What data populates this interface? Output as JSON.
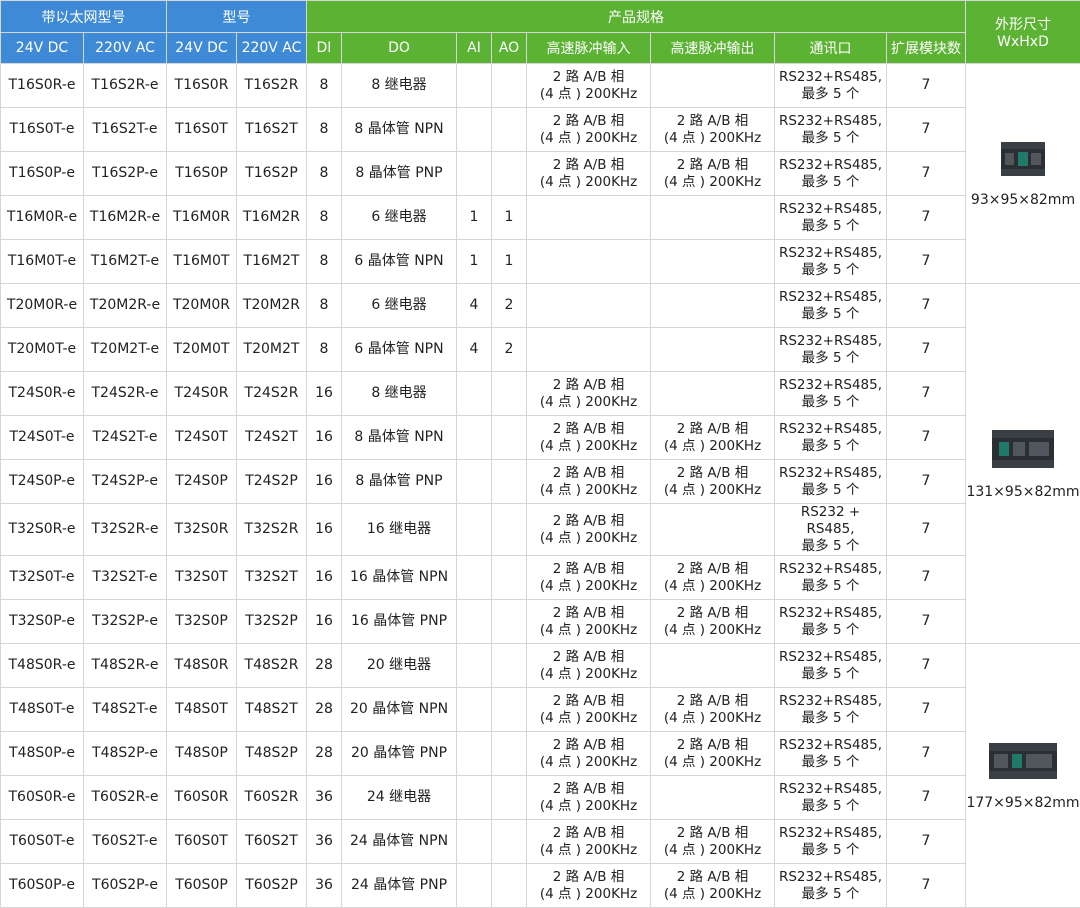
{
  "header": {
    "eth_model": "带以太网型号",
    "model": "型号",
    "spec": "产品规格",
    "dims": "外形尺寸",
    "dims_sub": "WxHxD",
    "v24": "24V DC",
    "v220": "220V AC",
    "di": "DI",
    "do": "DO",
    "ai": "AI",
    "ao": "AO",
    "hs_in": "高速脉冲输入",
    "hs_out": "高速脉冲输出",
    "comm": "通讯口",
    "ext": "扩展模块数"
  },
  "rows": [
    {
      "e24": "T16S0R-e",
      "e220": "T16S2R-e",
      "m24": "T16S0R",
      "m220": "T16S2R",
      "di": "8",
      "do": "8 继电器",
      "ai": "",
      "ao": "",
      "hin1": "2 路 A/B 相",
      "hin2": "(4 点 ) 200KHz",
      "hout1": "",
      "hout2": "",
      "comm1": "RS232+RS485,",
      "comm2": "最多 5 个",
      "ext": "7"
    },
    {
      "e24": "T16S0T-e",
      "e220": "T16S2T-e",
      "m24": "T16S0T",
      "m220": "T16S2T",
      "di": "8",
      "do": "8 晶体管 NPN",
      "ai": "",
      "ao": "",
      "hin1": "2 路 A/B 相",
      "hin2": "(4 点 ) 200KHz",
      "hout1": "2 路 A/B 相",
      "hout2": "(4 点 ) 200KHz",
      "comm1": "RS232+RS485,",
      "comm2": "最多 5 个",
      "ext": "7"
    },
    {
      "e24": "T16S0P-e",
      "e220": "T16S2P-e",
      "m24": "T16S0P",
      "m220": "T16S2P",
      "di": "8",
      "do": "8 晶体管 PNP",
      "ai": "",
      "ao": "",
      "hin1": "2 路 A/B 相",
      "hin2": "(4 点 ) 200KHz",
      "hout1": "2 路 A/B 相",
      "hout2": "(4 点 ) 200KHz",
      "comm1": "RS232+RS485,",
      "comm2": "最多 5 个",
      "ext": "7"
    },
    {
      "e24": "T16M0R-e",
      "e220": "T16M2R-e",
      "m24": "T16M0R",
      "m220": "T16M2R",
      "di": "8",
      "do": "6 继电器",
      "ai": "1",
      "ao": "1",
      "hin1": "",
      "hin2": "",
      "hout1": "",
      "hout2": "",
      "comm1": "RS232+RS485,",
      "comm2": "最多 5 个",
      "ext": "7"
    },
    {
      "e24": "T16M0T-e",
      "e220": "T16M2T-e",
      "m24": "T16M0T",
      "m220": "T16M2T",
      "di": "8",
      "do": "6 晶体管 NPN",
      "ai": "1",
      "ao": "1",
      "hin1": "",
      "hin2": "",
      "hout1": "",
      "hout2": "",
      "comm1": "RS232+RS485,",
      "comm2": "最多 5 个",
      "ext": "7"
    },
    {
      "e24": "T20M0R-e",
      "e220": "T20M2R-e",
      "m24": "T20M0R",
      "m220": "T20M2R",
      "di": "8",
      "do": "6 继电器",
      "ai": "4",
      "ao": "2",
      "hin1": "",
      "hin2": "",
      "hout1": "",
      "hout2": "",
      "comm1": "RS232+RS485,",
      "comm2": "最多 5 个",
      "ext": "7"
    },
    {
      "e24": "T20M0T-e",
      "e220": "T20M2T-e",
      "m24": "T20M0T",
      "m220": "T20M2T",
      "di": "8",
      "do": "6 晶体管 NPN",
      "ai": "4",
      "ao": "2",
      "hin1": "",
      "hin2": "",
      "hout1": "",
      "hout2": "",
      "comm1": "RS232+RS485,",
      "comm2": "最多 5 个",
      "ext": "7"
    },
    {
      "e24": "T24S0R-e",
      "e220": "T24S2R-e",
      "m24": "T24S0R",
      "m220": "T24S2R",
      "di": "16",
      "do": "8 继电器",
      "ai": "",
      "ao": "",
      "hin1": "2 路 A/B 相",
      "hin2": "(4 点 ) 200KHz",
      "hout1": "",
      "hout2": "",
      "comm1": "RS232+RS485,",
      "comm2": "最多 5 个",
      "ext": "7"
    },
    {
      "e24": "T24S0T-e",
      "e220": "T24S2T-e",
      "m24": "T24S0T",
      "m220": "T24S2T",
      "di": "16",
      "do": "8 晶体管 NPN",
      "ai": "",
      "ao": "",
      "hin1": "2 路 A/B 相",
      "hin2": "(4 点 ) 200KHz",
      "hout1": "2 路 A/B 相",
      "hout2": "(4 点 ) 200KHz",
      "comm1": "RS232+RS485,",
      "comm2": "最多 5 个",
      "ext": "7"
    },
    {
      "e24": "T24S0P-e",
      "e220": "T24S2P-e",
      "m24": "T24S0P",
      "m220": "T24S2P",
      "di": "16",
      "do": "8 晶体管 PNP",
      "ai": "",
      "ao": "",
      "hin1": "2 路 A/B 相",
      "hin2": "(4 点 ) 200KHz",
      "hout1": "2 路 A/B 相",
      "hout2": "(4 点 ) 200KHz",
      "comm1": "RS232+RS485,",
      "comm2": "最多 5 个",
      "ext": "7"
    },
    {
      "e24": "T32S0R-e",
      "e220": "T32S2R-e",
      "m24": "T32S0R",
      "m220": "T32S2R",
      "di": "16",
      "do": "16 继电器",
      "ai": "",
      "ao": "",
      "hin1": "2 路 A/B 相",
      "hin2": "(4 点 ) 200KHz",
      "hout1": "",
      "hout2": "",
      "comm1": "RS232 + RS485,",
      "comm2": "最多 5 个",
      "ext": "7"
    },
    {
      "e24": "T32S0T-e",
      "e220": "T32S2T-e",
      "m24": "T32S0T",
      "m220": "T32S2T",
      "di": "16",
      "do": "16 晶体管 NPN",
      "ai": "",
      "ao": "",
      "hin1": "2 路 A/B 相",
      "hin2": "(4 点 ) 200KHz",
      "hout1": "2 路 A/B 相",
      "hout2": "(4 点 ) 200KHz",
      "comm1": "RS232+RS485,",
      "comm2": "最多 5 个",
      "ext": "7"
    },
    {
      "e24": "T32S0P-e",
      "e220": "T32S2P-e",
      "m24": "T32S0P",
      "m220": "T32S2P",
      "di": "16",
      "do": "16 晶体管 PNP",
      "ai": "",
      "ao": "",
      "hin1": "2 路 A/B 相",
      "hin2": "(4 点 ) 200KHz",
      "hout1": "2 路 A/B 相",
      "hout2": "(4 点 ) 200KHz",
      "comm1": "RS232+RS485,",
      "comm2": "最多 5 个",
      "ext": "7"
    },
    {
      "e24": "T48S0R-e",
      "e220": "T48S2R-e",
      "m24": "T48S0R",
      "m220": "T48S2R",
      "di": "28",
      "do": "20 继电器",
      "ai": "",
      "ao": "",
      "hin1": "2 路 A/B 相",
      "hin2": "(4 点 ) 200KHz",
      "hout1": "",
      "hout2": "",
      "comm1": "RS232+RS485,",
      "comm2": "最多 5 个",
      "ext": "7"
    },
    {
      "e24": "T48S0T-e",
      "e220": "T48S2T-e",
      "m24": "T48S0T",
      "m220": "T48S2T",
      "di": "28",
      "do": "20 晶体管 NPN",
      "ai": "",
      "ao": "",
      "hin1": "2 路 A/B 相",
      "hin2": "(4 点 ) 200KHz",
      "hout1": "2 路 A/B 相",
      "hout2": "(4 点 ) 200KHz",
      "comm1": "RS232+RS485,",
      "comm2": "最多 5 个",
      "ext": "7"
    },
    {
      "e24": "T48S0P-e",
      "e220": "T48S2P-e",
      "m24": "T48S0P",
      "m220": "T48S2P",
      "di": "28",
      "do": "20 晶体管 PNP",
      "ai": "",
      "ao": "",
      "hin1": "2 路 A/B 相",
      "hin2": "(4 点 ) 200KHz",
      "hout1": "2 路 A/B 相",
      "hout2": "(4 点 ) 200KHz",
      "comm1": "RS232+RS485,",
      "comm2": "最多 5 个",
      "ext": "7"
    },
    {
      "e24": "T60S0R-e",
      "e220": "T60S2R-e",
      "m24": "T60S0R",
      "m220": "T60S2R",
      "di": "36",
      "do": "24 继电器",
      "ai": "",
      "ao": "",
      "hin1": "2 路 A/B 相",
      "hin2": "(4 点 ) 200KHz",
      "hout1": "",
      "hout2": "",
      "comm1": "RS232+RS485,",
      "comm2": "最多 5 个",
      "ext": "7"
    },
    {
      "e24": "T60S0T-e",
      "e220": "T60S2T-e",
      "m24": "T60S0T",
      "m220": "T60S2T",
      "di": "36",
      "do": "24 晶体管 NPN",
      "ai": "",
      "ao": "",
      "hin1": "2 路 A/B 相",
      "hin2": "(4 点 ) 200KHz",
      "hout1": "2 路 A/B 相",
      "hout2": "(4 点 ) 200KHz",
      "comm1": "RS232+RS485,",
      "comm2": "最多 5 个",
      "ext": "7"
    },
    {
      "e24": "T60S0P-e",
      "e220": "T60S2P-e",
      "m24": "T60S0P",
      "m220": "T60S2P",
      "di": "36",
      "do": "24 晶体管 PNP",
      "ai": "",
      "ao": "",
      "hin1": "2 路 A/B 相",
      "hin2": "(4 点 ) 200KHz",
      "hout1": "2 路 A/B 相",
      "hout2": "(4 点 ) 200KHz",
      "comm1": "RS232+RS485,",
      "comm2": "最多 5 个",
      "ext": "7"
    }
  ],
  "dimension_groups": [
    {
      "label": "93×95×82mm",
      "rows": 5,
      "icon": "plc-small-icon"
    },
    {
      "label": "131×95×82mm",
      "rows": 8,
      "icon": "plc-medium-icon"
    },
    {
      "label": "177×95×82mm",
      "rows": 6,
      "icon": "plc-large-icon"
    }
  ],
  "colors": {
    "header_blue": "#3e8ad6",
    "header_green": "#5bb233",
    "border": "#d6d6d6"
  }
}
